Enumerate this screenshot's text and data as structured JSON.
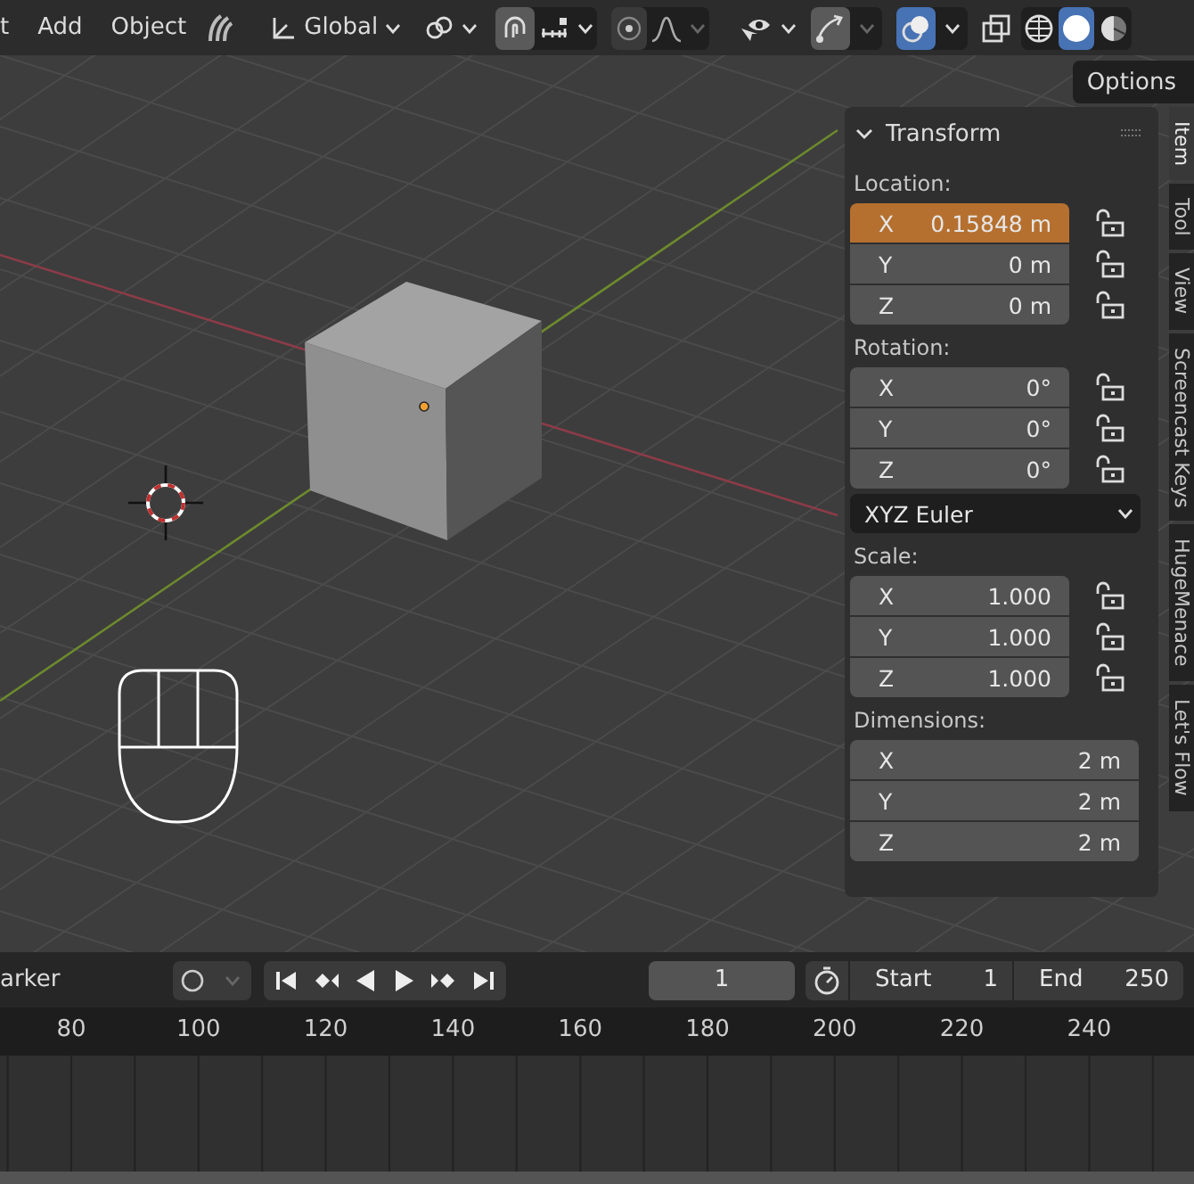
{
  "header": {
    "menus": [
      {
        "label": "t"
      },
      {
        "label": "Add"
      },
      {
        "label": "Object"
      }
    ],
    "orientation": {
      "value": "Global"
    },
    "snap": {
      "on": true
    },
    "overlays": {
      "on": true
    },
    "shading_modes": [
      {
        "kind": "wireframe",
        "selected": false
      },
      {
        "kind": "solid",
        "selected": true
      },
      {
        "kind": "material",
        "selected": false
      }
    ]
  },
  "viewport": {
    "options_button": "Options"
  },
  "sidebar": {
    "panel": {
      "title": "Transform",
      "expanded": true,
      "groups": [
        {
          "label": "Location:",
          "rows": [
            {
              "axis": "X",
              "value": "0.15848 m",
              "selected": true,
              "locked": false
            },
            {
              "axis": "Y",
              "value": "0 m",
              "selected": false,
              "locked": false
            },
            {
              "axis": "Z",
              "value": "0 m",
              "selected": false,
              "locked": false
            }
          ]
        },
        {
          "label": "Rotation:",
          "rows": [
            {
              "axis": "X",
              "value": "0°",
              "selected": false,
              "locked": false
            },
            {
              "axis": "Y",
              "value": "0°",
              "selected": false,
              "locked": false
            },
            {
              "axis": "Z",
              "value": "0°",
              "selected": false,
              "locked": false
            }
          ],
          "mode": "XYZ Euler"
        },
        {
          "label": "Scale:",
          "rows": [
            {
              "axis": "X",
              "value": "1.000",
              "selected": false,
              "locked": false
            },
            {
              "axis": "Y",
              "value": "1.000",
              "selected": false,
              "locked": false
            },
            {
              "axis": "Z",
              "value": "1.000",
              "selected": false,
              "locked": false
            }
          ]
        },
        {
          "label": "Dimensions:",
          "rows": [
            {
              "axis": "X",
              "value": "2 m",
              "selected": false
            },
            {
              "axis": "Y",
              "value": "2 m",
              "selected": false
            },
            {
              "axis": "Z",
              "value": "2 m",
              "selected": false
            }
          ]
        }
      ]
    },
    "tabs": [
      {
        "label": "Item",
        "selected": true
      },
      {
        "label": "Tool",
        "selected": false
      },
      {
        "label": "View",
        "selected": false
      },
      {
        "label": "Screencast Keys",
        "selected": false
      },
      {
        "label": "HugeMenace",
        "selected": false
      },
      {
        "label": "Let's Flow",
        "selected": false
      }
    ]
  },
  "timeline": {
    "marker_menu": "arker",
    "current_frame": "1",
    "start": {
      "label": "Start",
      "value": "1"
    },
    "end": {
      "label": "End",
      "value": "250"
    },
    "ruler": [
      "80",
      "100",
      "120",
      "140",
      "160",
      "180",
      "200",
      "220",
      "240"
    ]
  }
}
